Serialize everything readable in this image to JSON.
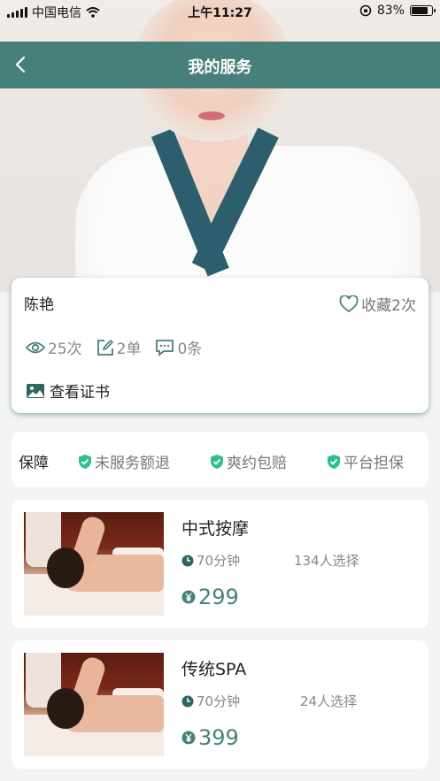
{
  "status_bar": {
    "carrier": "中国电信",
    "time": "上午11:27",
    "battery_percent": "83%",
    "battery_level": 0.83
  },
  "nav": {
    "title": "我的服务",
    "back_icon": "chevron-left-icon"
  },
  "profile": {
    "name": "陈艳",
    "favorites_label": "收藏2次",
    "stats": [
      {
        "icon": "eye-icon",
        "label": "25次"
      },
      {
        "icon": "edit-icon",
        "label": "2单"
      },
      {
        "icon": "comment-icon",
        "label": "0条"
      }
    ],
    "certificate_label": "查看证书"
  },
  "guarantee": {
    "label": "保障",
    "items": [
      "未服务额退",
      "爽约包赔",
      "平台担保"
    ],
    "icon_color": "#2fbf8f"
  },
  "services": [
    {
      "name": "中式按摩",
      "duration": "70分钟",
      "selected": "134人选择",
      "price": "299"
    },
    {
      "name": "传统SPA",
      "duration": "70分钟",
      "selected": "24人选择",
      "price": "399"
    }
  ],
  "colors": {
    "accent": "#47807a",
    "background": "#f3f3f3"
  }
}
